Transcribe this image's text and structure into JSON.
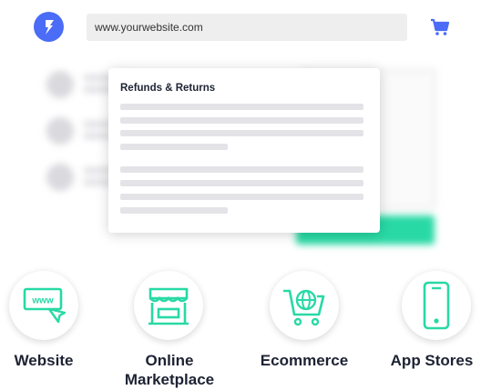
{
  "browser": {
    "url": "www.yourwebsite.com",
    "logo_icon": "bolt-logo-icon",
    "cart_icon": "shopping-cart-icon"
  },
  "popup": {
    "title": "Refunds & Returns"
  },
  "channels": [
    {
      "label_lines": [
        "Website"
      ],
      "icon": "website-www-icon"
    },
    {
      "label_lines": [
        "Online",
        "Marketplace"
      ],
      "icon": "marketplace-store-icon"
    },
    {
      "label_lines": [
        "Ecommerce"
      ],
      "icon": "ecommerce-cart-globe-icon"
    },
    {
      "label_lines": [
        "App Stores"
      ],
      "icon": "mobile-phone-icon"
    }
  ],
  "colors": {
    "accent_blue": "#4a6cf7",
    "accent_green": "#28d9a5",
    "text_dark": "#1d2333"
  }
}
